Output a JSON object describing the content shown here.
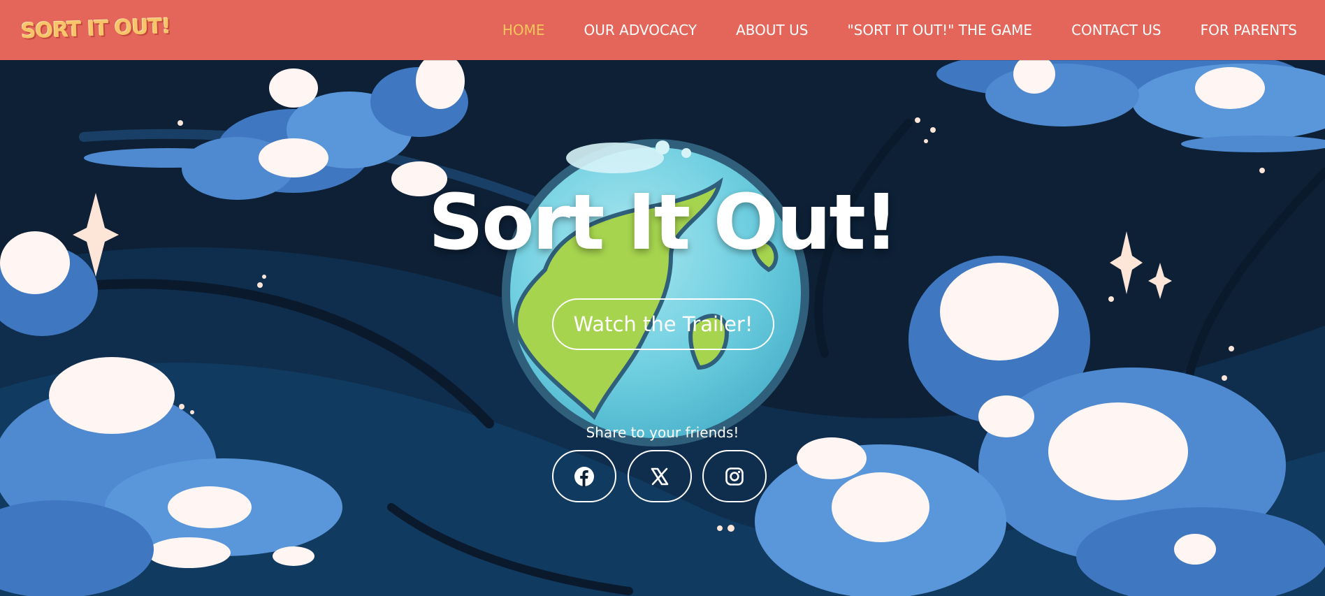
{
  "header": {
    "logo_text": "SORT IT OUT!",
    "nav": [
      {
        "label": "HOME",
        "active": true
      },
      {
        "label": "OUR ADVOCACY"
      },
      {
        "label": "ABOUT US"
      },
      {
        "label": "\"SORT IT OUT!\" THE GAME"
      },
      {
        "label": "CONTACT US"
      },
      {
        "label": "FOR PARENTS"
      }
    ]
  },
  "hero": {
    "title": "Sort It Out!",
    "cta_label": "Watch the Trailer!",
    "share_label": "Share to your friends!",
    "social": [
      {
        "name": "facebook",
        "icon": "facebook-icon"
      },
      {
        "name": "x",
        "icon": "x-icon"
      },
      {
        "name": "instagram",
        "icon": "instagram-icon"
      }
    ]
  },
  "colors": {
    "navbar": "#e4665a",
    "active_nav": "#f7c65a",
    "nav_text": "#ffffff",
    "sky": "#0d2036"
  }
}
